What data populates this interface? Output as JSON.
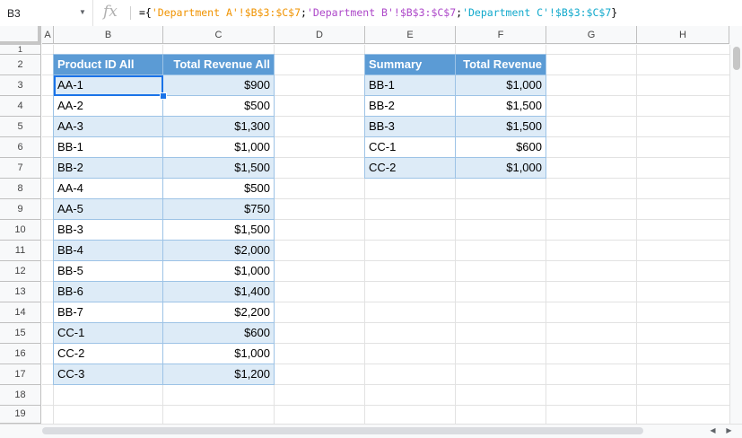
{
  "name_box": {
    "value": "B3"
  },
  "formula_bar": {
    "fx_label": "fx",
    "tokens": [
      {
        "text": "={",
        "cls": "tok-p"
      },
      {
        "text": "'Department A'!$B$3:$C$7",
        "cls": "tok-a"
      },
      {
        "text": ";",
        "cls": "tok-p"
      },
      {
        "text": "'Department B'!$B$3:$C$7",
        "cls": "tok-b"
      },
      {
        "text": ";",
        "cls": "tok-p"
      },
      {
        "text": "'Department C'!$B$3:$C$7",
        "cls": "tok-c"
      },
      {
        "text": "}",
        "cls": "tok-p"
      }
    ]
  },
  "columns": [
    "A",
    "B",
    "C",
    "D",
    "E",
    "F",
    "G",
    "H"
  ],
  "rows": [
    "1",
    "2",
    "3",
    "4",
    "5",
    "6",
    "7",
    "8",
    "9",
    "10",
    "11",
    "12",
    "13",
    "14",
    "15",
    "16",
    "17",
    "18",
    "19"
  ],
  "table_all": {
    "headers": [
      "Product ID All",
      "Total Revenue All"
    ],
    "rows": [
      [
        "AA-1",
        "$900"
      ],
      [
        "AA-2",
        "$500"
      ],
      [
        "AA-3",
        "$1,300"
      ],
      [
        "BB-1",
        "$1,000"
      ],
      [
        "BB-2",
        "$1,500"
      ],
      [
        "AA-4",
        "$500"
      ],
      [
        "AA-5",
        "$750"
      ],
      [
        "BB-3",
        "$1,500"
      ],
      [
        "BB-4",
        "$2,000"
      ],
      [
        "BB-5",
        "$1,000"
      ],
      [
        "BB-6",
        "$1,400"
      ],
      [
        "BB-7",
        "$2,200"
      ],
      [
        "CC-1",
        "$600"
      ],
      [
        "CC-2",
        "$1,000"
      ],
      [
        "CC-3",
        "$1,200"
      ]
    ]
  },
  "table_summary": {
    "headers": [
      "Summary",
      "Total Revenue"
    ],
    "rows": [
      [
        "BB-1",
        "$1,000"
      ],
      [
        "BB-2",
        "$1,500"
      ],
      [
        "BB-3",
        "$1,500"
      ],
      [
        "CC-1",
        "$600"
      ],
      [
        "CC-2",
        "$1,000"
      ]
    ]
  },
  "colors": {
    "header_fill": "#5b9bd5",
    "band_fill": "#ddebf7",
    "selection": "#1a73e8"
  }
}
